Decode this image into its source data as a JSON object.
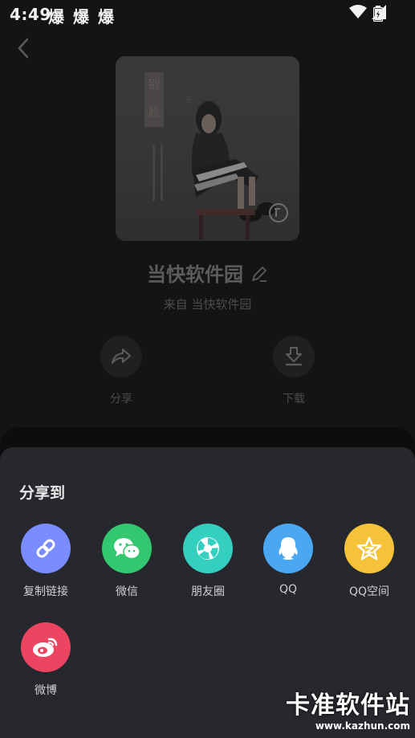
{
  "status_bar": {
    "time": "4:49",
    "notifications": [
      "爆",
      "爆",
      "爆"
    ]
  },
  "song": {
    "title": "当快软件园",
    "subtitle": "来自  当快软件园",
    "cover_text": "别 脸"
  },
  "actions": [
    {
      "label": "分享",
      "icon": "share-icon"
    },
    {
      "label": "下载",
      "icon": "download-icon"
    }
  ],
  "share_sheet": {
    "title": "分享到",
    "items": [
      {
        "label": "复制链接",
        "icon": "link-icon",
        "color": "#7a8cff"
      },
      {
        "label": "微信",
        "icon": "wechat-icon",
        "color": "#33c870"
      },
      {
        "label": "朋友圈",
        "icon": "moments-icon",
        "color": "#35cfc0"
      },
      {
        "label": "QQ",
        "icon": "qq-icon",
        "color": "#4aa8f2"
      },
      {
        "label": "QQ空间",
        "icon": "qzone-icon",
        "color": "#f6c23a"
      },
      {
        "label": "微博",
        "icon": "weibo-icon",
        "color": "#ec4461"
      }
    ]
  },
  "watermark": {
    "text": "卡准软件站",
    "url": "www.kazhun.com"
  }
}
